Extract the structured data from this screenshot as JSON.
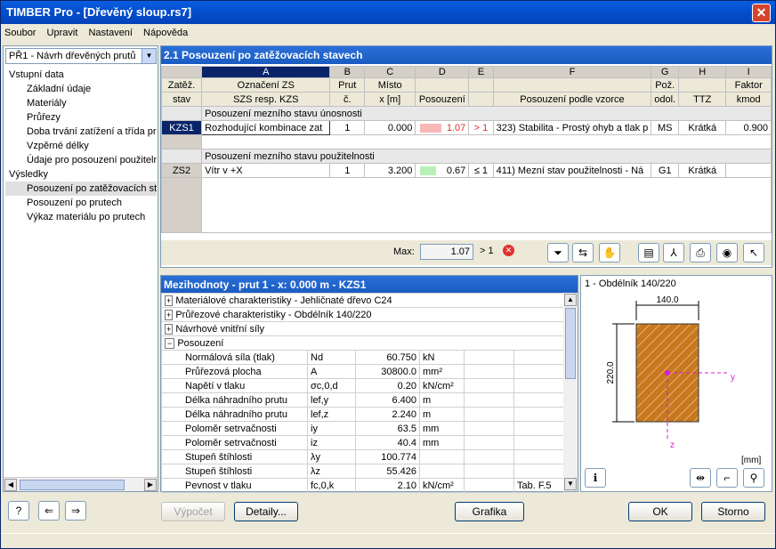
{
  "title": "TIMBER Pro - [Dřevěný sloup.rs7]",
  "menu": [
    "Soubor",
    "Upravit",
    "Nastavení",
    "Nápověda"
  ],
  "combo": "PŘ1 - Návrh dřevěných prutů",
  "tree": [
    {
      "label": "Vstupní data",
      "level": 1
    },
    {
      "label": "Základní údaje",
      "level": 2
    },
    {
      "label": "Materiály",
      "level": 2
    },
    {
      "label": "Průřezy",
      "level": 2
    },
    {
      "label": "Doba trvání zatížení a třída pro",
      "level": 2
    },
    {
      "label": "Vzpěrné délky",
      "level": 2
    },
    {
      "label": "Údaje pro posouzení použitelnc",
      "level": 2
    },
    {
      "label": "Výsledky",
      "level": 1
    },
    {
      "label": "Posouzení po zatěžovacích sta",
      "level": 2,
      "selected": true
    },
    {
      "label": "Posouzení po prutech",
      "level": 2
    },
    {
      "label": "Výkaz materiálu po prutech",
      "level": 2
    }
  ],
  "table_title": "2.1 Posouzení po zatěžovacích stavech",
  "columns": [
    "A",
    "B",
    "C",
    "D",
    "E",
    "F",
    "G",
    "H",
    "I"
  ],
  "subhdr1": [
    "Zatěž.",
    "Označení ZS",
    "Prut",
    "Místo",
    "",
    "",
    "",
    "Pož.",
    "",
    "Faktor"
  ],
  "subhdr2": [
    "stav",
    "SZS resp. KZS",
    "č.",
    "x [m]",
    "Posouzení",
    "",
    "Posouzení podle vzorce",
    "odol.",
    "TTZ",
    "kmod"
  ],
  "group1": "Posouzení mezního stavu únosnosti",
  "group2": "Posouzení mezního stavu použitelnosti",
  "row1": {
    "id": "KZS1",
    "name": "Rozhodující kombinace zat",
    "member": "1",
    "x": "0.000",
    "ratio": "1.07",
    "cmp": "> 1",
    "formula": "323) Stabilita - Prostý ohyb a tlak p",
    "res": "MS",
    "ttz": "Krátká",
    "kmod": "0.900"
  },
  "row2": {
    "id": "ZS2",
    "name": "Vítr v +X",
    "member": "1",
    "x": "3.200",
    "ratio": "0.67",
    "cmp": "≤ 1",
    "formula": "411) Mezní stav použitelnosti - Ná",
    "res": "G1",
    "ttz": "Krátká",
    "kmod": ""
  },
  "max_label": "Max:",
  "max_value": "1.07",
  "max_cmp": "> 1",
  "detail_title": "Mezihodnoty - prut 1 - x: 0.000 m - KZS1",
  "detail_groups": [
    "Materiálové charakteristiky - Jehličnaté dřevo C24",
    "Průřezové charakteristiky - Obdélník 140/220",
    "Návrhové vnitřní síly",
    "Posouzení"
  ],
  "detail_rows": [
    {
      "name": "Normálová síla (tlak)",
      "sym": "Nd",
      "val": "60.750",
      "unit": "kN",
      "ref": ""
    },
    {
      "name": "Průřezová plocha",
      "sym": "A",
      "val": "30800.0",
      "unit": "mm²",
      "ref": ""
    },
    {
      "name": "Napětí v tlaku",
      "sym": "σc,0,d",
      "val": "0.20",
      "unit": "kN/cm²",
      "ref": ""
    },
    {
      "name": "Délka náhradního prutu",
      "sym": "lef,y",
      "val": "6.400",
      "unit": "m",
      "ref": ""
    },
    {
      "name": "Délka náhradního prutu",
      "sym": "lef,z",
      "val": "2.240",
      "unit": "m",
      "ref": ""
    },
    {
      "name": "Poloměr setrvačnosti",
      "sym": "iy",
      "val": "63.5",
      "unit": "mm",
      "ref": ""
    },
    {
      "name": "Poloměr setrvačnosti",
      "sym": "iz",
      "val": "40.4",
      "unit": "mm",
      "ref": ""
    },
    {
      "name": "Stupeň štíhlosti",
      "sym": "λy",
      "val": "100.774",
      "unit": "",
      "ref": ""
    },
    {
      "name": "Stupeň štíhlosti",
      "sym": "λz",
      "val": "55.426",
      "unit": "",
      "ref": ""
    },
    {
      "name": "Pevnost v tlaku",
      "sym": "fc,0,k",
      "val": "2.10",
      "unit": "kN/cm²",
      "ref": "Tab. F.5"
    }
  ],
  "section_title": "1 - Obdélník 140/220",
  "dim_w": "140.0",
  "dim_h": "220.0",
  "axis_y": "y",
  "axis_z": "z",
  "units": "[mm]",
  "buttons": {
    "calc": "Výpočet",
    "details": "Detaily...",
    "graphics": "Grafika",
    "ok": "OK",
    "cancel": "Storno"
  },
  "colors": {
    "section_fill": "#c8781e",
    "accent": "#0a246a",
    "warn": "#e03030"
  }
}
